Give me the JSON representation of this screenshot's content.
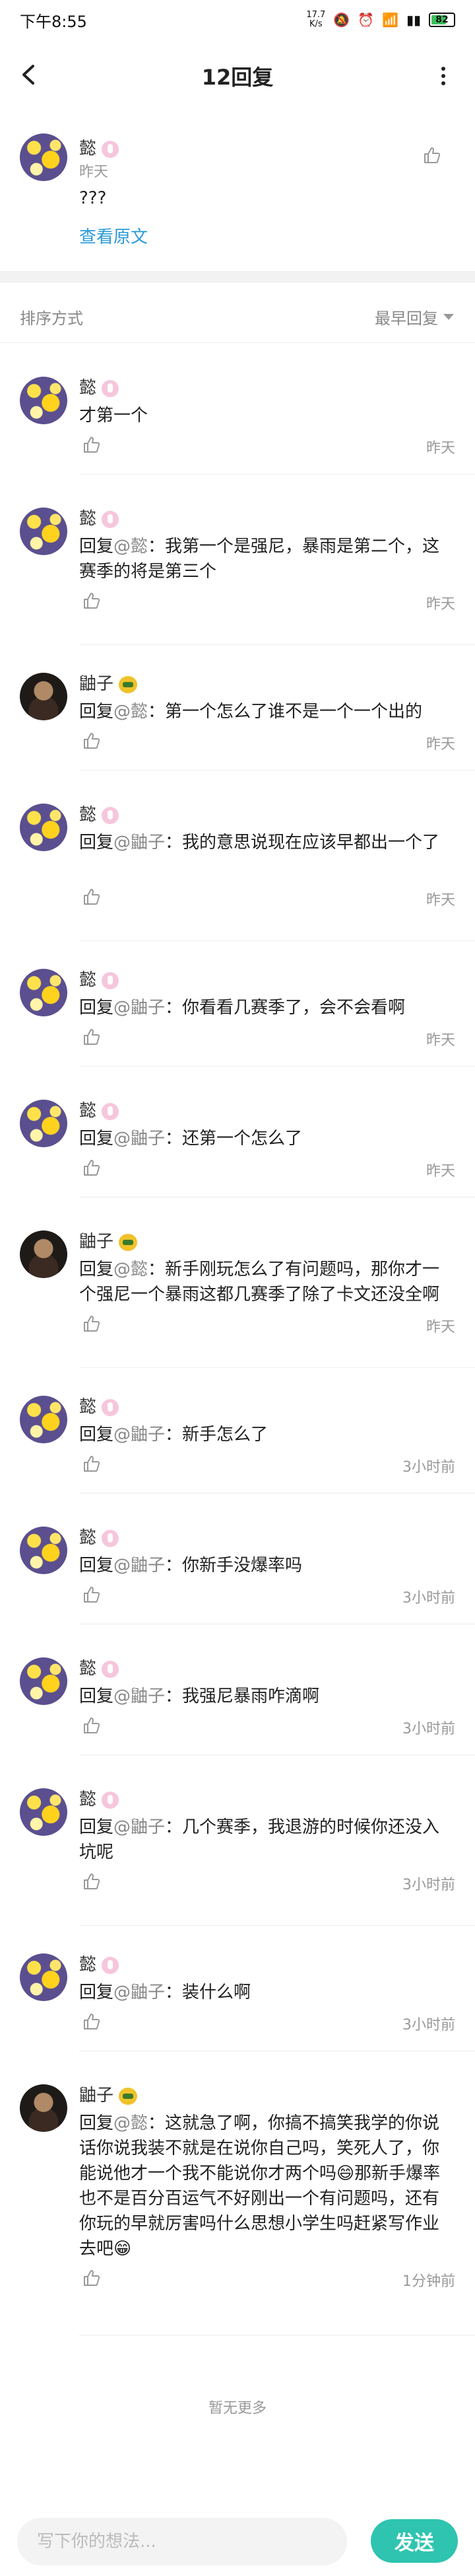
{
  "status_bar": {
    "time": "下午8:55",
    "net_speed_value": "17.7",
    "net_speed_unit": "K/s",
    "battery": "82"
  },
  "header": {
    "title": "12回复"
  },
  "post": {
    "author": "懿",
    "time": "昨天",
    "body": "???",
    "view_original": "查看原文"
  },
  "sort": {
    "label": "排序方式",
    "selected": "最早回复"
  },
  "replies": [
    {
      "author": "懿",
      "avatar": "flower",
      "badge": "pink",
      "prefix": "",
      "mention": "",
      "text": "才第一个",
      "time": "昨天"
    },
    {
      "author": "懿",
      "avatar": "flower",
      "badge": "pink",
      "prefix": "回复",
      "mention": "@懿",
      "text": "：我第一个是强尼，暴雨是第二个，这赛季的将是第三个",
      "time": "昨天"
    },
    {
      "author": "鼬子",
      "avatar": "dark",
      "badge": "yellow",
      "prefix": "回复",
      "mention": "@懿",
      "text": "：第一个怎么了谁不是一个一个出的",
      "time": "昨天"
    },
    {
      "author": "懿",
      "avatar": "flower",
      "badge": "pink",
      "prefix": "回复",
      "mention": "@鼬子",
      "text": "：我的意思说现在应该早都出一个了",
      "time": "昨天"
    },
    {
      "author": "懿",
      "avatar": "flower",
      "badge": "pink",
      "prefix": "回复",
      "mention": "@鼬子",
      "text": "：你看看几赛季了，会不会看啊",
      "time": "昨天"
    },
    {
      "author": "懿",
      "avatar": "flower",
      "badge": "pink",
      "prefix": "回复",
      "mention": "@鼬子",
      "text": "：还第一个怎么了",
      "time": "昨天"
    },
    {
      "author": "鼬子",
      "avatar": "dark",
      "badge": "yellow",
      "prefix": "回复",
      "mention": "@懿",
      "text": "：新手刚玩怎么了有问题吗，那你才一个强尼一个暴雨这都几赛季了除了卡文还没全啊",
      "time": "昨天"
    },
    {
      "author": "懿",
      "avatar": "flower",
      "badge": "pink",
      "prefix": "回复",
      "mention": "@鼬子",
      "text": "：新手怎么了",
      "time": "3小时前"
    },
    {
      "author": "懿",
      "avatar": "flower",
      "badge": "pink",
      "prefix": "回复",
      "mention": "@鼬子",
      "text": "：你新手没爆率吗",
      "time": "3小时前"
    },
    {
      "author": "懿",
      "avatar": "flower",
      "badge": "pink",
      "prefix": "回复",
      "mention": "@鼬子",
      "text": "：我强尼暴雨咋滴啊",
      "time": "3小时前"
    },
    {
      "author": "懿",
      "avatar": "flower",
      "badge": "pink",
      "prefix": "回复",
      "mention": "@鼬子",
      "text": "：几个赛季，我退游的时候你还没入坑呢",
      "time": "3小时前"
    },
    {
      "author": "懿",
      "avatar": "flower",
      "badge": "pink",
      "prefix": "回复",
      "mention": "@鼬子",
      "text": "：装什么啊",
      "time": "3小时前"
    },
    {
      "author": "鼬子",
      "avatar": "dark",
      "badge": "yellow",
      "prefix": "回复",
      "mention": "@懿",
      "text": "：这就急了啊，你搞不搞笑我学的你说话你说我装不就是在说你自己吗，笑死人了，你能说他才一个我不能说你才两个吗😄那新手爆率也不是百分百运气不好刚出一个有问题吗，还有你玩的早就厉害吗什么思想小学生吗赶紧写作业去吧😁",
      "time": "1分钟前"
    }
  ],
  "footer": {
    "no_more": "暂无更多"
  },
  "composer": {
    "placeholder": "写下你的想法...",
    "send_label": "发送"
  },
  "colors": {
    "accent": "#2ec4b0",
    "link": "#2b9ad6",
    "muted": "#999999"
  }
}
